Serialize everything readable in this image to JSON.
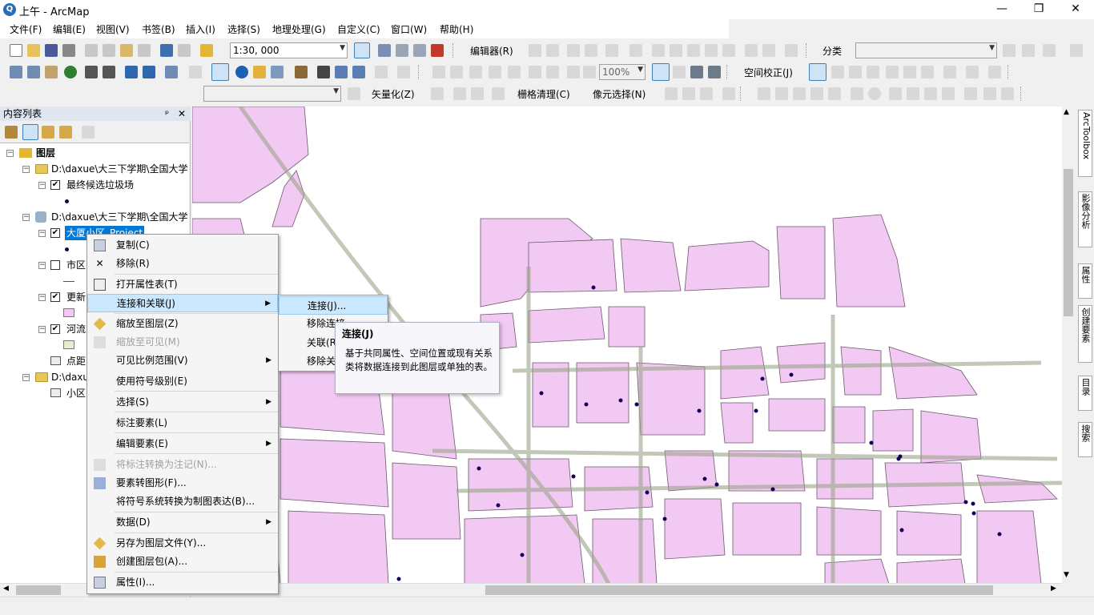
{
  "window": {
    "title": "上午 - ArcMap",
    "app_icon": "arcmap-globe-icon",
    "min": "—",
    "max": "❐",
    "close": "✕"
  },
  "menu": [
    "文件(F)",
    "编辑(E)",
    "视图(V)",
    "书签(B)",
    "插入(I)",
    "选择(S)",
    "地理处理(G)",
    "自定义(C)",
    "窗口(W)",
    "帮助(H)"
  ],
  "toolbar": {
    "scale": "1:30, 000",
    "editor": "编辑器(R)",
    "classify": "分类",
    "georef": "空间校正(J)",
    "zoom_pct": "100%",
    "vectorize": "矢量化(Z)",
    "raster_clean": "栅格清理(C)",
    "pixel_select": "像元选择(N)"
  },
  "toc": {
    "title": "内容列表",
    "pin": "ᵖ",
    "close": "✕",
    "layers_root": "图层",
    "folder1": "D:\\daxue\\大三下学期\\全国大学",
    "layer1": "最终候选垃圾场",
    "folder2": "D:\\daxue\\大三下学期\\全国大学",
    "layer2_selected": "大厦小区_Project",
    "layer3": "市区",
    "layer4": "更新",
    "layer5": "河流",
    "table1": "点距",
    "folder3": "D:\\daxu",
    "table2": "小区"
  },
  "context_menu": [
    {
      "label": "复制(C)",
      "icon": "copy-icon",
      "disabled": false
    },
    {
      "label": "移除(R)",
      "icon": "remove-x-icon",
      "disabled": false
    },
    {
      "label": "打开属性表(T)",
      "icon": "attribute-table-icon",
      "disabled": false
    },
    {
      "label": "连接和关联(J)",
      "icon": "",
      "disabled": false,
      "submenu": true,
      "highlighted": true
    },
    {
      "label": "缩放至图层(Z)",
      "icon": "zoom-to-layer-icon",
      "disabled": false
    },
    {
      "label": "缩放至可见(M)",
      "icon": "zoom-visible-icon",
      "disabled": true
    },
    {
      "label": "可见比例范围(V)",
      "icon": "",
      "disabled": false,
      "submenu": true
    },
    {
      "label": "使用符号级别(E)",
      "icon": "",
      "disabled": false
    },
    {
      "label": "选择(S)",
      "icon": "",
      "disabled": false,
      "submenu": true
    },
    {
      "label": "标注要素(L)",
      "icon": "",
      "disabled": false
    },
    {
      "label": "编辑要素(E)",
      "icon": "",
      "disabled": false,
      "submenu": true
    },
    {
      "label": "将标注转换为注记(N)...",
      "icon": "convert-labels-icon",
      "disabled": true
    },
    {
      "label": "要素转图形(F)...",
      "icon": "features-to-graphics-icon",
      "disabled": false
    },
    {
      "label": "将符号系统转换为制图表达(B)...",
      "icon": "",
      "disabled": false
    },
    {
      "label": "数据(D)",
      "icon": "",
      "disabled": false,
      "submenu": true
    },
    {
      "label": "另存为图层文件(Y)...",
      "icon": "save-layer-icon",
      "disabled": false
    },
    {
      "label": "创建图层包(A)...",
      "icon": "layer-package-icon",
      "disabled": false
    },
    {
      "label": "属性(I)...",
      "icon": "properties-icon",
      "disabled": false
    }
  ],
  "submenu": [
    "连接(J)...",
    "移除连接",
    "关联(R)",
    "移除关联"
  ],
  "tooltip": {
    "title": "连接(J)",
    "body": "基于共同属性、空间位置或现有关系类将数据连接到此图层或单独的表。"
  },
  "right_dock": [
    "ArcToolbox",
    "影像分析",
    "属性",
    "创建要素",
    "目录",
    "搜索"
  ],
  "colors": {
    "parcel_fill": "#f2c9f2",
    "parcel_stroke": "#6a5a6a",
    "road_green": "#e6eed2",
    "point": "#14005a",
    "highlight": "#cce8ff",
    "selection": "#0078d7"
  }
}
